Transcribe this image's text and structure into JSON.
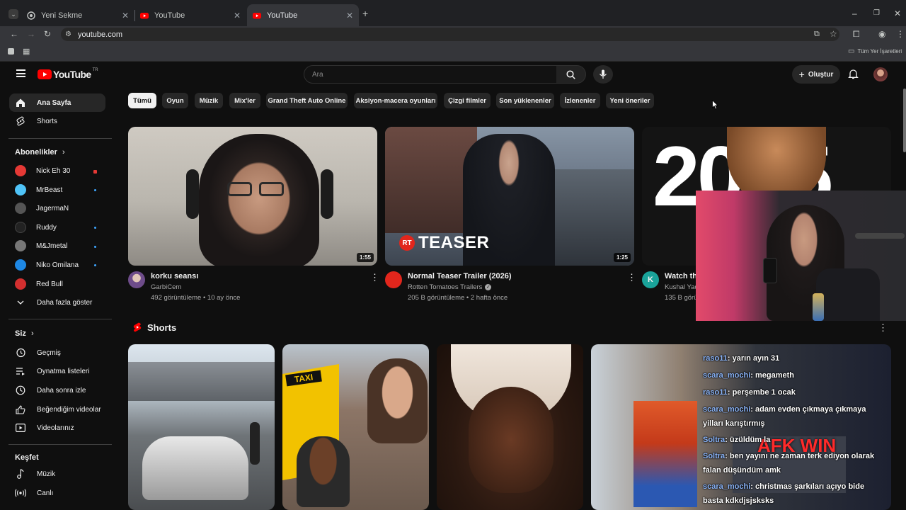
{
  "browser": {
    "tabs": [
      {
        "title": "Yeni Sekme"
      },
      {
        "title": "YouTube"
      },
      {
        "title": "YouTube"
      }
    ],
    "url": "youtube.com",
    "bookmarks_label": "Tüm Yer İşaretleri"
  },
  "masthead": {
    "logo": "YouTube",
    "region": "TR",
    "search_placeholder": "Ara",
    "create_label": "Oluştur"
  },
  "sidebar": {
    "main": [
      {
        "label": "Ana Sayfa",
        "icon": "home-icon"
      },
      {
        "label": "Shorts",
        "icon": "shorts-icon"
      }
    ],
    "subs_title": "Abonelikler",
    "subs": [
      {
        "label": "Nick Eh 30",
        "color": "#e53935"
      },
      {
        "label": "MrBeast",
        "color": "#4fc3f7"
      },
      {
        "label": "JagermaN",
        "color": "#555555"
      },
      {
        "label": "Ruddy",
        "color": "#222222"
      },
      {
        "label": "M&Jmetal",
        "color": "#777777"
      },
      {
        "label": "Niko Omilana",
        "color": "#1e88e5"
      },
      {
        "label": "Red Bull",
        "color": "#d32f2f"
      }
    ],
    "show_more": "Daha fazla göster",
    "you_title": "Siz",
    "you": [
      {
        "label": "Geçmiş",
        "icon": "history-icon"
      },
      {
        "label": "Oynatma listeleri",
        "icon": "playlists-icon"
      },
      {
        "label": "Daha sonra izle",
        "icon": "watch-later-icon"
      },
      {
        "label": "Beğendiğim videolar",
        "icon": "liked-icon"
      },
      {
        "label": "Videolarınız",
        "icon": "your-videos-icon"
      }
    ],
    "explore_title": "Keşfet",
    "explore": [
      {
        "label": "Müzik",
        "icon": "music-icon"
      },
      {
        "label": "Canlı",
        "icon": "live-icon"
      }
    ]
  },
  "chips": [
    "Tümü",
    "Oyun",
    "Müzik",
    "Mix'ler",
    "Grand Theft Auto Online",
    "Aksiyon-macera oyunları",
    "Çizgi filmler",
    "Son yüklenenler",
    "İzlenenler",
    "Yeni öneriler"
  ],
  "videos": [
    {
      "title": "korku seansı",
      "channel": "GarbiCem",
      "meta": "492 görüntüleme • 10 ay önce",
      "duration": "1:55"
    },
    {
      "title": "Normal Teaser Trailer (2026)",
      "channel": "Rotten Tomatoes Trailers",
      "meta": "205 B görüntüleme • 2 hafta önce",
      "duration": "1:25",
      "thumb_text": "TEASER",
      "thumb_badge": "RT"
    },
    {
      "title": "Watch thi",
      "channel": "Kushal Yac",
      "meta": "135 B görü",
      "avatar_letter": "K",
      "thumb_text": "2025"
    }
  ],
  "shorts_title": "Shorts",
  "stream_chat": [
    {
      "user": "raso11",
      "msg": ": yarın ayın 31"
    },
    {
      "user": "scara_mochi",
      "msg": ": megameth"
    },
    {
      "user": "raso11",
      "msg": ": perşembe 1 ocak"
    },
    {
      "user": "scara_mochi",
      "msg": ": adam evden çıkmaya çıkmaya"
    },
    {
      "user": "",
      "msg": "yilları karıştırmış"
    },
    {
      "user": "Soltra",
      "msg": ": üzüldüm la"
    },
    {
      "user": "Soltra",
      "msg": ": ben yayını ne zaman terk ediyon olarak"
    },
    {
      "user": "",
      "msg": "falan düşündüm amk"
    },
    {
      "user": "scara_mochi",
      "msg": ": christmas şarkıları açıyo bide"
    },
    {
      "user": "",
      "msg": "basta kdkdjsjsksks"
    }
  ],
  "colors": {
    "background": "#0f0f0f",
    "accent": "#ff0000",
    "chip": "#272727",
    "chip_selected": "#f1f1f1"
  }
}
